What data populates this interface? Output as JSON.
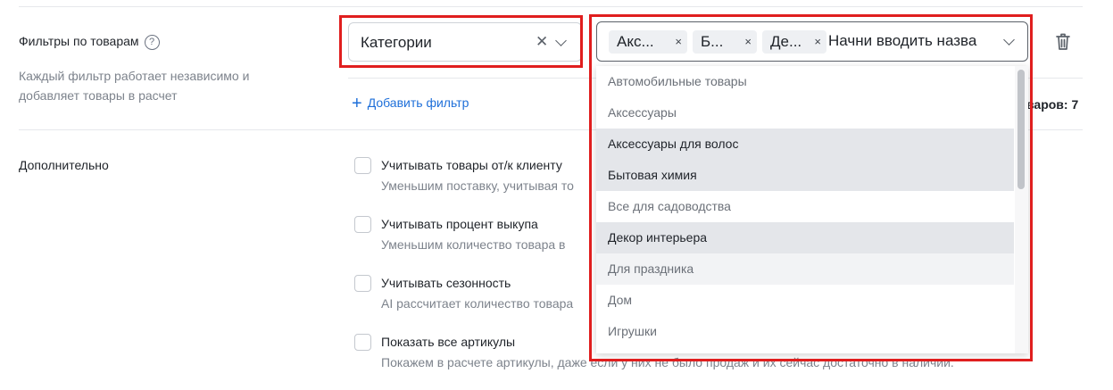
{
  "filters": {
    "title": "Фильтры по товарам",
    "help_icon": "?",
    "description": "Каждый фильтр работает независимо и добавляет товары в расчет",
    "filter_type": {
      "value": "Категории"
    },
    "tags": [
      "Акс...",
      "Б...",
      "Де..."
    ],
    "tag_remove": "×",
    "input_placeholder": "Начни вводить назва",
    "add_filter_plus": "+",
    "add_filter_label": "Добавить фильтр",
    "right_info": "варов: 7"
  },
  "dropdown": {
    "options": [
      "Автомобильные товары",
      "Аксессуары",
      "Аксессуары для волос",
      "Бытовая химия",
      "Все для садоводства",
      "Декор интерьера",
      "Для праздника",
      "Дом",
      "Игрушки"
    ],
    "selected": [
      2,
      3,
      5
    ],
    "hovered": 6
  },
  "additional": {
    "title": "Дополнительно",
    "options": [
      {
        "label": "Учитывать товары от/к клиенту",
        "desc": "Уменьшим поставку, учитывая то"
      },
      {
        "label": "Учитывать процент выкупа",
        "desc": "Уменьшим количество товара в"
      },
      {
        "label": "Учитывать сезонность",
        "desc": "AI рассчитает количество товара"
      },
      {
        "label": "Показать все артикулы",
        "desc": "Покажем в расчете артикулы, даже если у них не было продаж и их сейчас достаточно в наличии."
      }
    ]
  },
  "icons": {
    "clear": "close-icon",
    "chevron": "chevron-down-icon",
    "delete": "trash-icon"
  }
}
